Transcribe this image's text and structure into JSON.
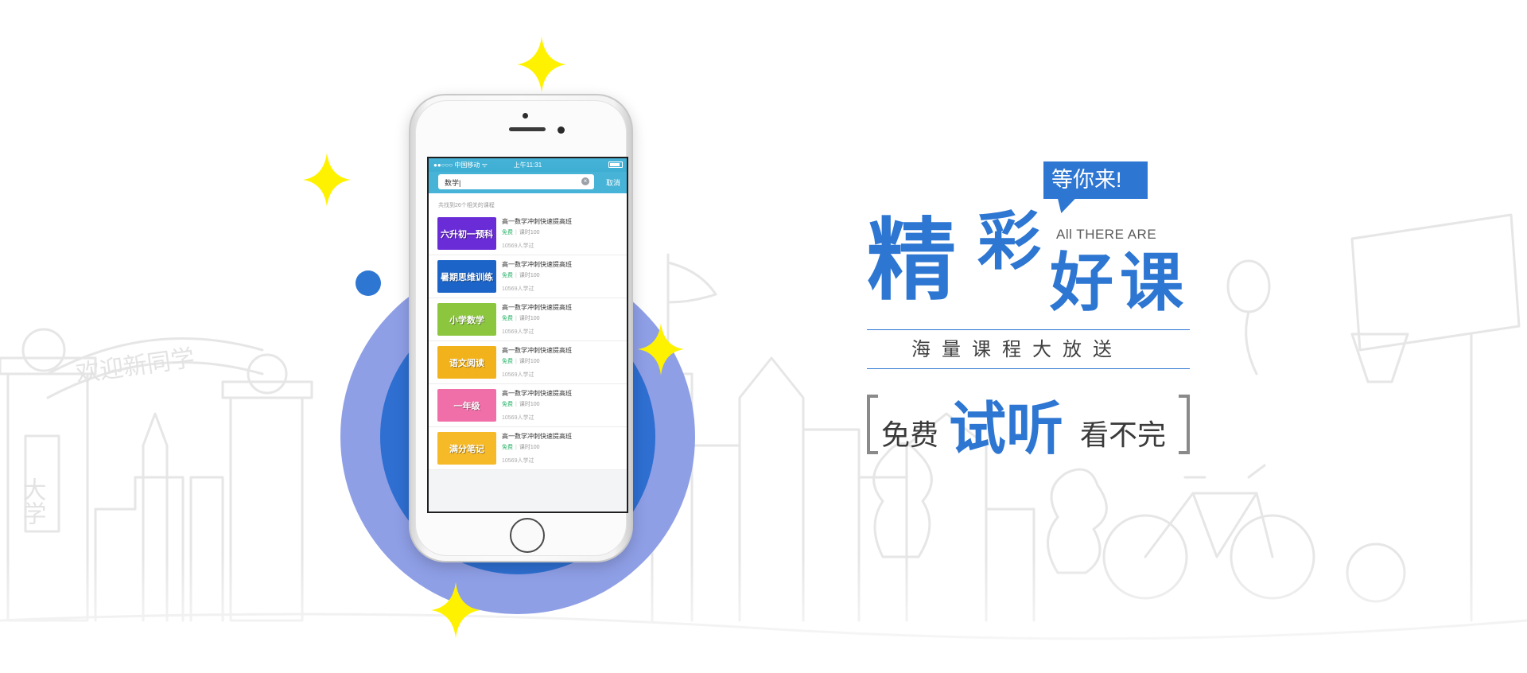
{
  "phone": {
    "status": {
      "carrier": "●●○○○ 中国移动 ᯤ",
      "time": "上午11:31"
    },
    "search": {
      "query": "数学|",
      "cancel_label": "取消"
    },
    "result_count": "共找到26个相关的课程",
    "courses": [
      {
        "thumb_text": "六升初一预科",
        "thumb_color": "#6a2cd6",
        "title": "高一数学冲刺快速提高班",
        "price": "免费",
        "lessons": "课时100",
        "students": "10569人学过"
      },
      {
        "thumb_text": "暑期思维训练",
        "thumb_color": "#1c64c8",
        "title": "高一数学冲刺快速提高班",
        "price": "免费",
        "lessons": "课时100",
        "students": "10569人学过"
      },
      {
        "thumb_text": "小学数学",
        "thumb_color": "#8cc63f",
        "title": "高一数学冲刺快速提高班",
        "price": "免费",
        "lessons": "课时100",
        "students": "10569人学过"
      },
      {
        "thumb_text": "语文阅读",
        "thumb_color": "#f2b21b",
        "title": "高一数学冲刺快速提高班",
        "price": "免费",
        "lessons": "课时100",
        "students": "10569人学过"
      },
      {
        "thumb_text": "一年级",
        "thumb_color": "#f06fa8",
        "title": "高一数学冲刺快速提高班",
        "price": "免费",
        "lessons": "课时100",
        "students": "10569人学过"
      },
      {
        "thumb_text": "满分笔记",
        "thumb_color": "#f6b928",
        "title": "高一数学冲刺快速提高班",
        "price": "免费",
        "lessons": "课时100",
        "students": "10569人学过"
      }
    ]
  },
  "promo": {
    "bubble": "等你来!",
    "headline_chars": [
      "精",
      "彩",
      "好",
      "课"
    ],
    "english": "All THERE ARE",
    "subline": "海量课程大放送",
    "cta_a": "免费",
    "cta_b": "试听",
    "cta_c": "看不完"
  },
  "background": {
    "arch_text": "欢迎新同学",
    "pillar_text": "大学"
  },
  "colors": {
    "brand_blue": "#2d76d2",
    "circle_light": "#8f9fe6",
    "sparkle": "#fff200",
    "status_teal": "#46b3d7"
  }
}
